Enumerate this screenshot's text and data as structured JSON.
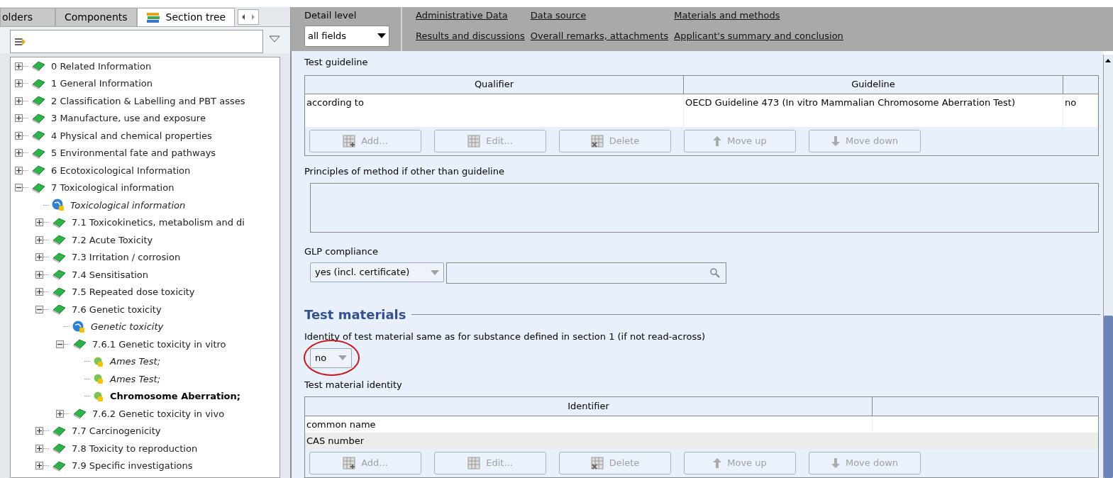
{
  "left_tabs": [
    {
      "label": "olders",
      "selected": false,
      "kind": "text"
    },
    {
      "label": "Components",
      "selected": false,
      "kind": "text"
    },
    {
      "label": "Section tree",
      "selected": true,
      "kind": "iconic"
    }
  ],
  "tree": [
    {
      "label": "0 Related Information",
      "kind": "book",
      "expanded": false,
      "selected": false
    },
    {
      "label": "1 General Information",
      "kind": "book",
      "expanded": false,
      "selected": false
    },
    {
      "label": "2 Classification & Labelling and PBT asses",
      "kind": "book",
      "expanded": false,
      "selected": false
    },
    {
      "label": "3 Manufacture, use and exposure",
      "kind": "book",
      "expanded": false,
      "selected": false
    },
    {
      "label": "4 Physical and chemical properties",
      "kind": "book",
      "expanded": false,
      "selected": false
    },
    {
      "label": "5 Environmental fate and pathways",
      "kind": "book",
      "expanded": false,
      "selected": false
    },
    {
      "label": "6 Ecotoxicological Information",
      "kind": "book",
      "expanded": false,
      "selected": false
    },
    {
      "label": "7 Toxicological information",
      "kind": "book",
      "expanded": true,
      "selected": false,
      "children": [
        {
          "label": "Toxicological information",
          "kind": "info",
          "selected": false
        },
        {
          "label": "7.1 Toxicokinetics, metabolism and di",
          "kind": "book",
          "expanded": false,
          "selected": false
        },
        {
          "label": "7.2 Acute Toxicity",
          "kind": "book",
          "expanded": false,
          "selected": false
        },
        {
          "label": "7.3 Irritation / corrosion",
          "kind": "book",
          "expanded": false,
          "selected": false
        },
        {
          "label": "7.4 Sensitisation",
          "kind": "book",
          "expanded": false,
          "selected": false
        },
        {
          "label": "7.5 Repeated dose toxicity",
          "kind": "book",
          "expanded": false,
          "selected": false
        },
        {
          "label": "7.6 Genetic toxicity",
          "kind": "book",
          "expanded": true,
          "selected": false,
          "children": [
            {
              "label": "Genetic toxicity",
              "kind": "info",
              "selected": false
            },
            {
              "label": "7.6.1 Genetic toxicity in vitro",
              "kind": "book",
              "expanded": true,
              "selected": false,
              "children": [
                {
                  "label": "Ames Test;",
                  "kind": "record",
                  "selected": false
                },
                {
                  "label": "Ames Test;",
                  "kind": "record",
                  "selected": false
                },
                {
                  "label": "Chromosome Aberration;",
                  "kind": "record",
                  "selected": true
                }
              ]
            },
            {
              "label": "7.6.2 Genetic toxicity in vivo",
              "kind": "book",
              "expanded": false,
              "selected": false
            }
          ]
        },
        {
          "label": "7.7 Carcinogenicity",
          "kind": "book",
          "expanded": false,
          "selected": false
        },
        {
          "label": "7.8 Toxicity to reproduction",
          "kind": "book",
          "expanded": false,
          "selected": false
        },
        {
          "label": "7.9 Specific investigations",
          "kind": "book",
          "expanded": false,
          "selected": false
        }
      ]
    }
  ],
  "header": {
    "detail_level_label": "Detail level",
    "detail_level_value": "all fields",
    "links": [
      [
        "Administrative Data",
        "Data source",
        "Materials and methods"
      ],
      [
        "Results and discussions",
        "Overall remarks, attachments",
        "Applicant's summary and conclusion"
      ]
    ]
  },
  "test_guideline": {
    "label": "Test guideline",
    "columns": [
      "Qualifier",
      "Guideline"
    ],
    "rows": [
      [
        "according to",
        "OECD Guideline 473 (In vitro Mammalian Chromosome Aberration Test)",
        "no"
      ]
    ],
    "buttons": [
      {
        "label": "Add...",
        "disabled": true
      },
      {
        "label": "Edit...",
        "disabled": true
      },
      {
        "label": "Delete",
        "disabled": true
      },
      {
        "label": "Move up",
        "disabled": true
      },
      {
        "label": "Move down",
        "disabled": true
      }
    ]
  },
  "principles": {
    "label": "Principles of method if other than guideline"
  },
  "glp": {
    "label": "GLP compliance",
    "value": "yes (incl. certificate)"
  },
  "test_materials": {
    "heading": "Test materials",
    "identity_label": "Identity of test material same as for substance defined in section 1 (if not read-across)",
    "identity_value": "no",
    "identity_highlighted": true,
    "table_label": "Test material identity",
    "columns": [
      "Identifier"
    ],
    "rows": [
      [
        "common name"
      ],
      [
        "CAS number"
      ]
    ],
    "buttons": [
      {
        "label": "Add...",
        "disabled": true
      },
      {
        "label": "Edit...",
        "disabled": true
      },
      {
        "label": "Delete",
        "disabled": true
      },
      {
        "label": "Move up",
        "disabled": true
      },
      {
        "label": "Move down",
        "disabled": true
      }
    ]
  }
}
